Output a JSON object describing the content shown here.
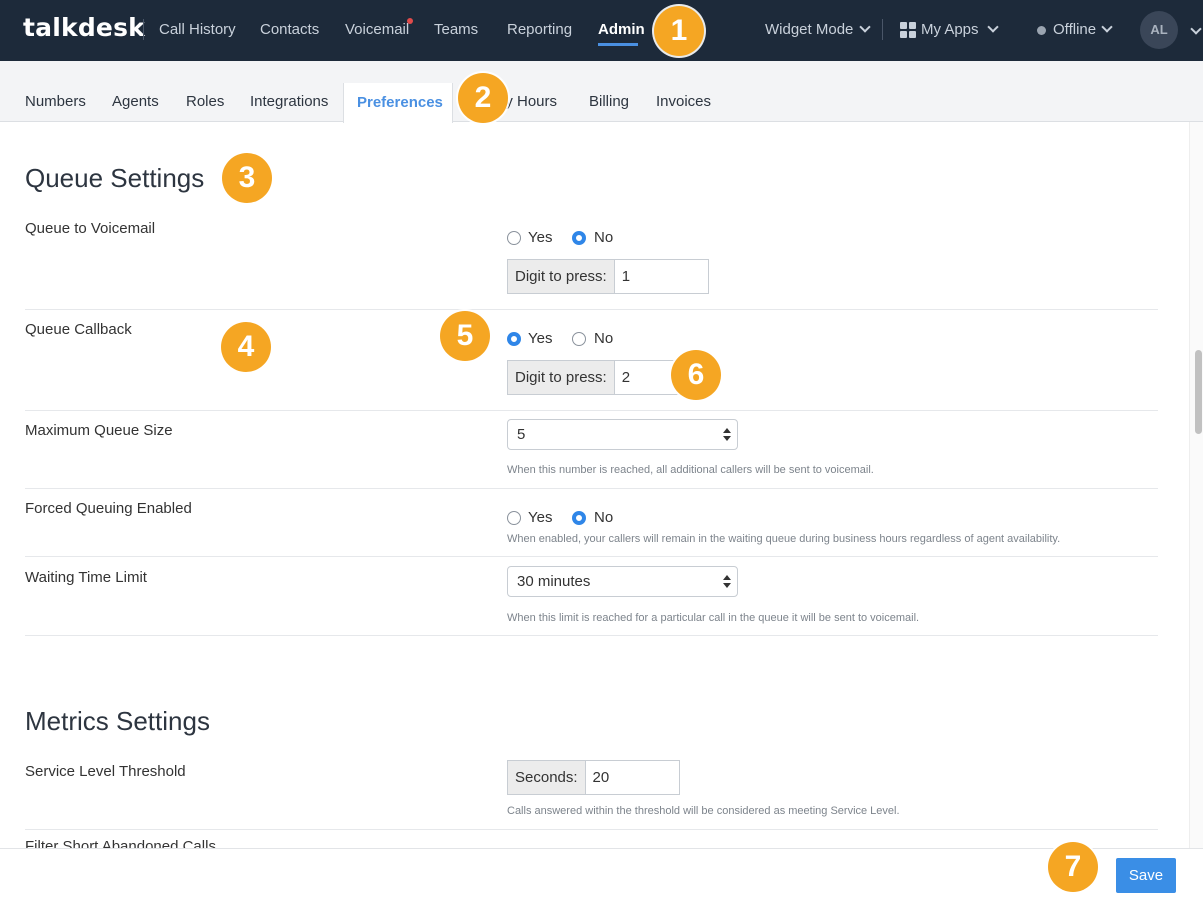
{
  "app": {
    "logo": "talkdesk"
  },
  "nav": {
    "items": [
      "Call History",
      "Contacts",
      "Voicemail",
      "Teams",
      "Reporting",
      "Admin"
    ],
    "widget_mode": "Widget Mode",
    "my_apps": "My Apps",
    "status": "Offline",
    "avatar_initials": "AL"
  },
  "subtabs": [
    "Numbers",
    "Agents",
    "Roles",
    "Integrations",
    "Preferences",
    "ay Hours",
    "Billing",
    "Invoices"
  ],
  "queue_settings": {
    "title": "Queue Settings",
    "queue_to_voicemail": {
      "label": "Queue to Voicemail",
      "yes": "Yes",
      "no": "No",
      "selected": "No",
      "digit_label": "Digit to press:",
      "digit_value": "1"
    },
    "queue_callback": {
      "label": "Queue Callback",
      "yes": "Yes",
      "no": "No",
      "selected": "Yes",
      "digit_label": "Digit to press:",
      "digit_value": "2"
    },
    "max_queue_size": {
      "label": "Maximum Queue Size",
      "value": "5",
      "help": "When this number is reached, all additional callers will be sent to voicemail."
    },
    "forced_queuing": {
      "label": "Forced Queuing Enabled",
      "yes": "Yes",
      "no": "No",
      "selected": "No",
      "help": "When enabled, your callers will remain in the waiting queue during business hours regardless of agent availability."
    },
    "waiting_time_limit": {
      "label": "Waiting Time Limit",
      "value": "30 minutes",
      "help": "When this limit is reached for a particular call in the queue it will be sent to voicemail."
    }
  },
  "metrics_settings": {
    "title": "Metrics Settings",
    "service_level": {
      "label": "Service Level Threshold",
      "seconds_label": "Seconds:",
      "seconds_value": "20",
      "help": "Calls answered within the threshold will be considered as meeting Service Level."
    },
    "filter_short": {
      "label": "Filter Short Abandoned Calls"
    }
  },
  "footer": {
    "save_label": "Save"
  },
  "callouts": [
    "1",
    "2",
    "3",
    "4",
    "5",
    "6",
    "7"
  ],
  "colors": {
    "nav_bg": "#1d2a3a",
    "accent": "#4a90e2",
    "callout": "#f5a623",
    "save_button": "#3a8ee6"
  }
}
